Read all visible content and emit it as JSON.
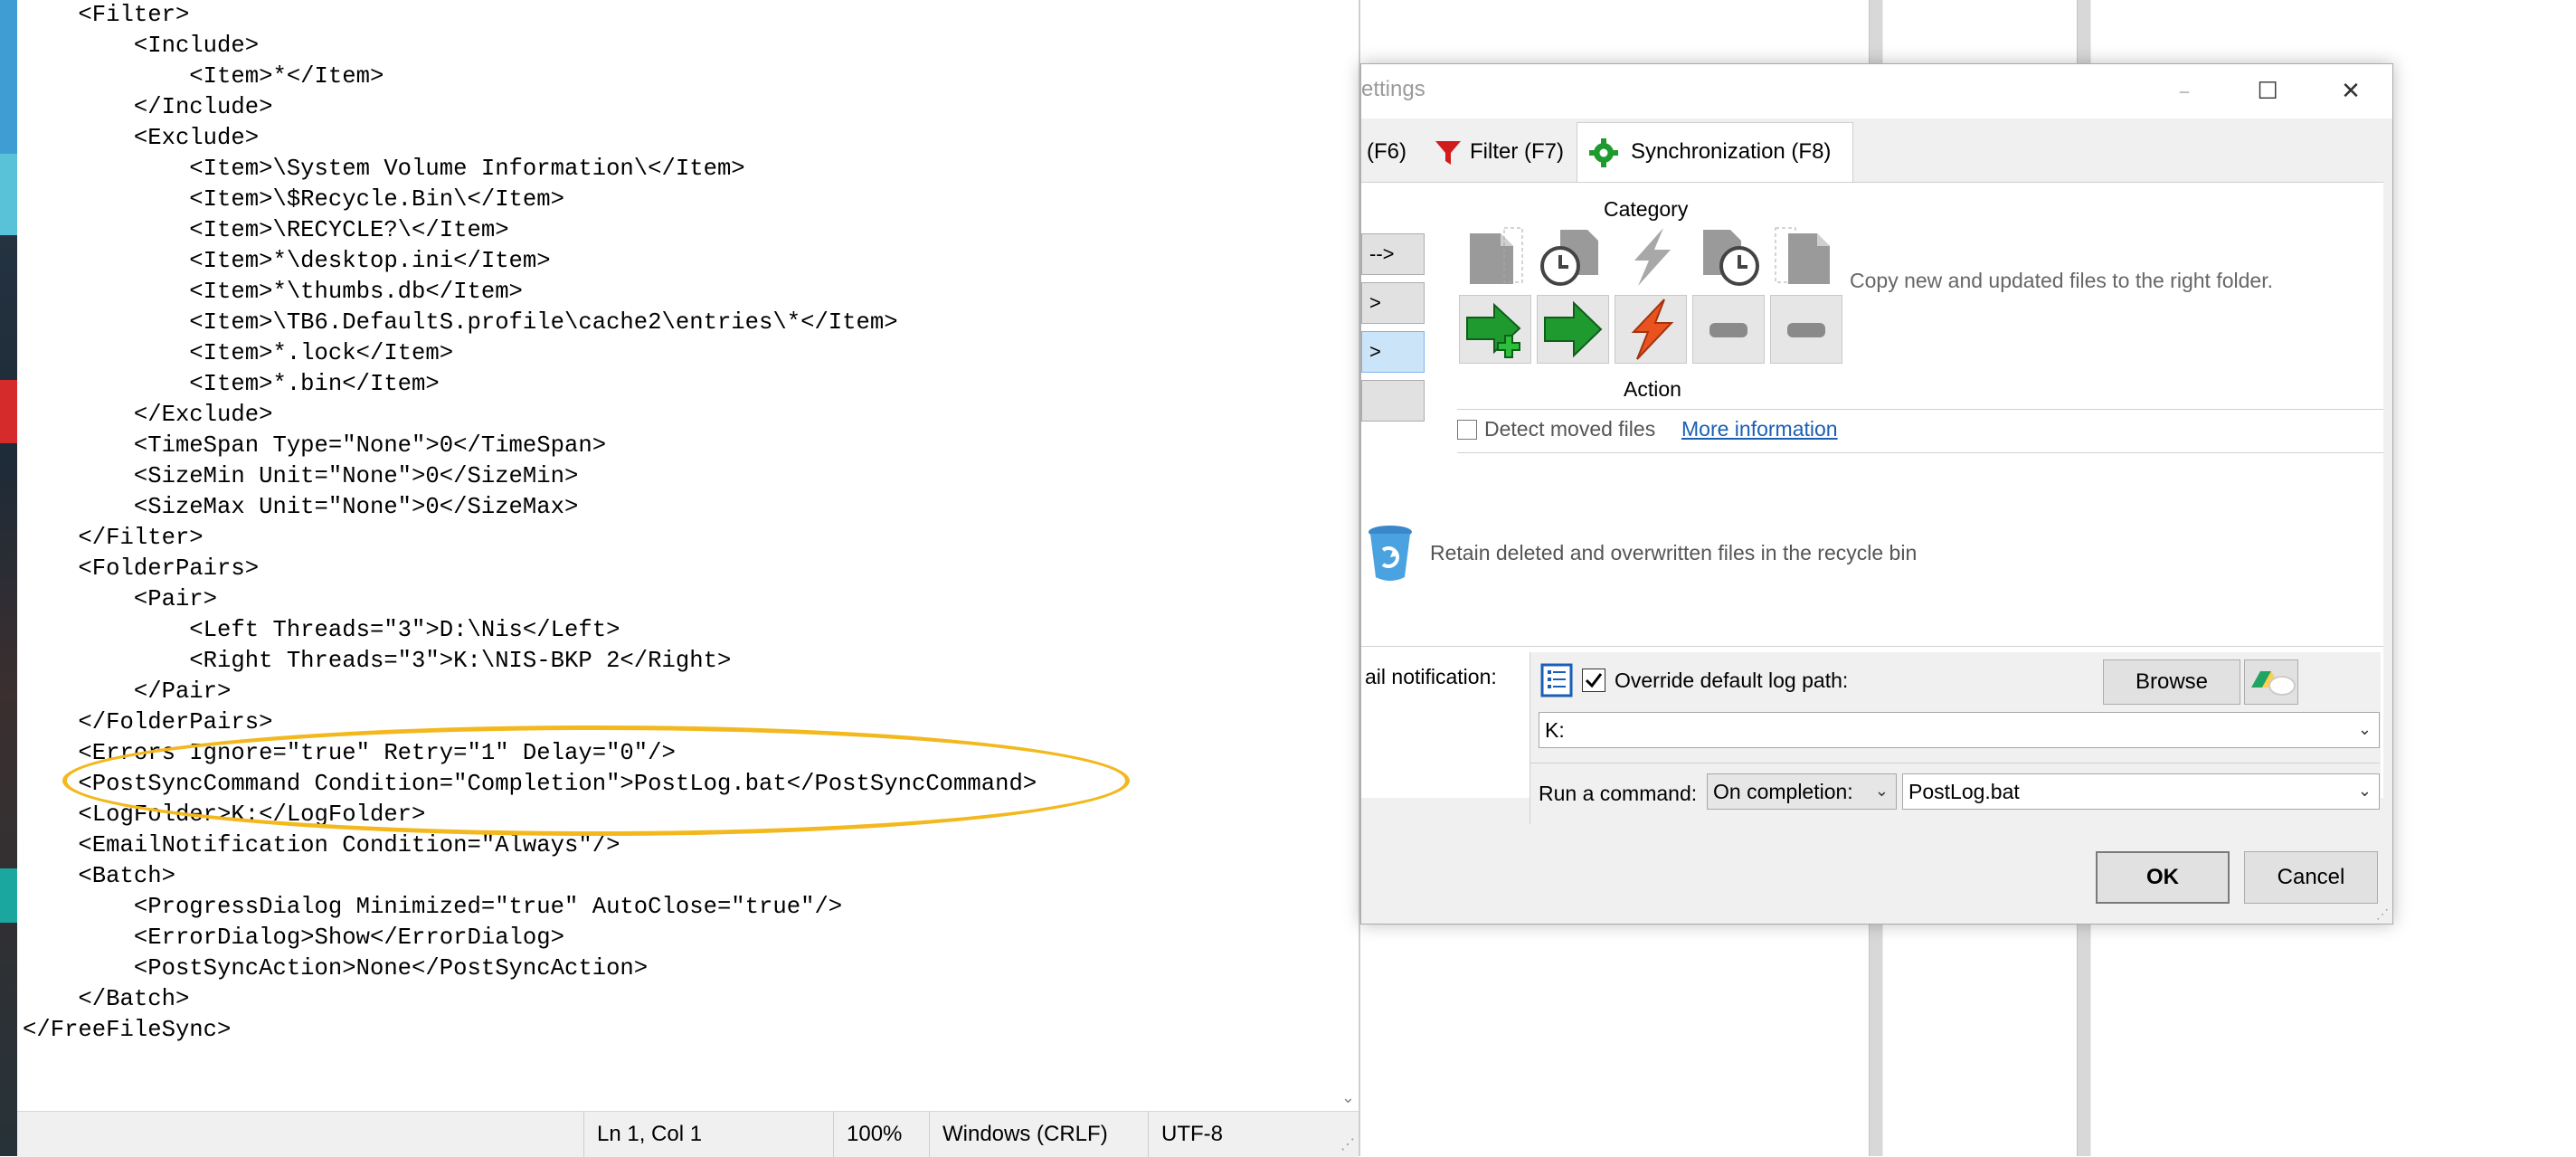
{
  "notepad": {
    "lines": [
      "    <Filter>",
      "        <Include>",
      "            <Item>*</Item>",
      "        </Include>",
      "        <Exclude>",
      "            <Item>\\System Volume Information\\</Item>",
      "            <Item>\\$Recycle.Bin\\</Item>",
      "            <Item>\\RECYCLE?\\</Item>",
      "            <Item>*\\desktop.ini</Item>",
      "            <Item>*\\thumbs.db</Item>",
      "            <Item>\\TB6.DefaultS.profile\\cache2\\entries\\*</Item>",
      "            <Item>*.lock</Item>",
      "            <Item>*.bin</Item>",
      "        </Exclude>",
      "        <TimeSpan Type=\"None\">0</TimeSpan>",
      "        <SizeMin Unit=\"None\">0</SizeMin>",
      "        <SizeMax Unit=\"None\">0</SizeMax>",
      "    </Filter>",
      "    <FolderPairs>",
      "        <Pair>",
      "            <Left Threads=\"3\">D:\\Nis</Left>",
      "            <Right Threads=\"3\">K:\\NIS-BKP 2</Right>",
      "        </Pair>",
      "    </FolderPairs>",
      "    <Errors Ignore=\"true\" Retry=\"1\" Delay=\"0\"/>",
      "    <PostSyncCommand Condition=\"Completion\">PostLog.bat</PostSyncCommand>",
      "    <LogFolder>K:</LogFolder>",
      "    <EmailNotification Condition=\"Always\"/>",
      "    <Batch>",
      "        <ProgressDialog Minimized=\"true\" AutoClose=\"true\"/>",
      "        <ErrorDialog>Show</ErrorDialog>",
      "        <PostSyncAction>None</PostSyncAction>",
      "    </Batch>",
      "</FreeFileSync>"
    ],
    "status": {
      "position": "Ln 1, Col 1",
      "zoom": "100%",
      "line_ending": "Windows (CRLF)",
      "encoding": "UTF-8"
    }
  },
  "dialog": {
    "title": "ettings",
    "tabs": {
      "left_partial": "(F6)",
      "filter": "Filter (F7)",
      "sync": "Synchronization (F8)"
    },
    "variant_buttons": [
      "-->",
      ">",
      ">",
      ""
    ],
    "category_label": "Category",
    "action_label": "Action",
    "category_description": "Copy new and updated files to the right folder.",
    "detect_moved_label": "Detect moved files",
    "more_info_link": "More information",
    "recycle_label": "Retain deleted and overwritten files in the recycle bin",
    "email_label": "ail notification:",
    "override_log_label": "Override default log path:",
    "browse_label": "Browse",
    "log_path_value": "K:",
    "run_command_label": "Run a command:",
    "run_condition_value": "On completion:",
    "command_value": "PostLog.bat",
    "ok_label": "OK",
    "cancel_label": "Cancel",
    "colors": {
      "highlight": "#f2b81e",
      "action_green": "#1f9a2f",
      "action_orange": "#e8531f",
      "link": "#1a5fb4"
    }
  }
}
